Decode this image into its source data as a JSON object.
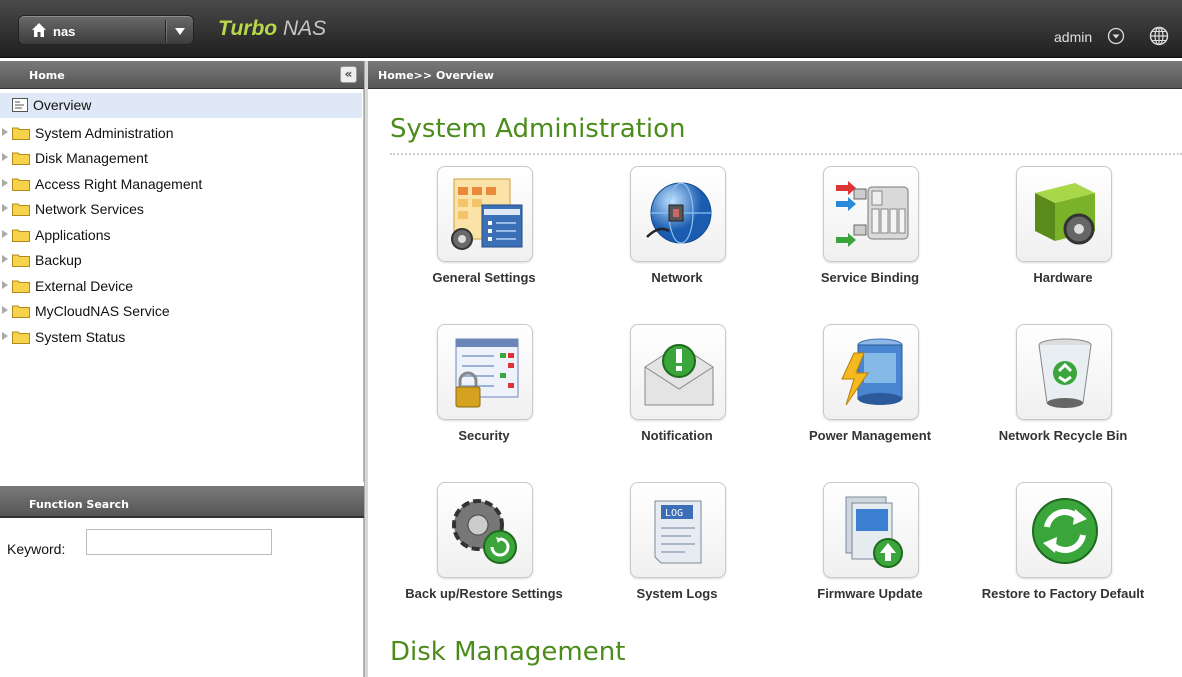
{
  "topbar": {
    "nas_name": "nas",
    "brand_bold": "Turbo",
    "brand_light": "NAS",
    "user": "admin"
  },
  "sidebar": {
    "header": "Home",
    "collapse_glyph": "«",
    "items": [
      {
        "label": "Overview",
        "selected": true
      },
      {
        "label": "System Administration"
      },
      {
        "label": "Disk Management"
      },
      {
        "label": "Access Right Management"
      },
      {
        "label": "Network Services"
      },
      {
        "label": "Applications"
      },
      {
        "label": "Backup"
      },
      {
        "label": "External Device"
      },
      {
        "label": "MyCloudNAS Service"
      },
      {
        "label": "System Status"
      }
    ]
  },
  "function_search": {
    "header": "Function Search",
    "keyword_label": "Keyword:",
    "keyword_value": ""
  },
  "main": {
    "breadcrumb": "Home>> Overview",
    "section_title": "System Administration",
    "next_section_title": "Disk Management",
    "tiles": [
      {
        "label": "General Settings",
        "icon": "general-settings-icon"
      },
      {
        "label": "Network",
        "icon": "network-globe-icon"
      },
      {
        "label": "Service Binding",
        "icon": "service-binding-icon"
      },
      {
        "label": "Hardware",
        "icon": "hardware-icon"
      },
      {
        "label": "Security",
        "icon": "security-lock-icon"
      },
      {
        "label": "Notification",
        "icon": "notification-envelope-icon"
      },
      {
        "label": "Power Management",
        "icon": "power-management-icon"
      },
      {
        "label": "Network Recycle Bin",
        "icon": "recycle-bin-icon"
      },
      {
        "label": "Back up/Restore Settings",
        "icon": "backup-restore-icon"
      },
      {
        "label": "System Logs",
        "icon": "system-logs-icon"
      },
      {
        "label": "Firmware Update",
        "icon": "firmware-update-icon"
      },
      {
        "label": "Restore to Factory Default",
        "icon": "factory-default-icon"
      }
    ]
  },
  "colors": {
    "accent_green": "#4c8c1c",
    "brand_green": "#b8d84a",
    "header_gray": "#5a5a5a",
    "selection_blue": "#dfe8f6"
  }
}
